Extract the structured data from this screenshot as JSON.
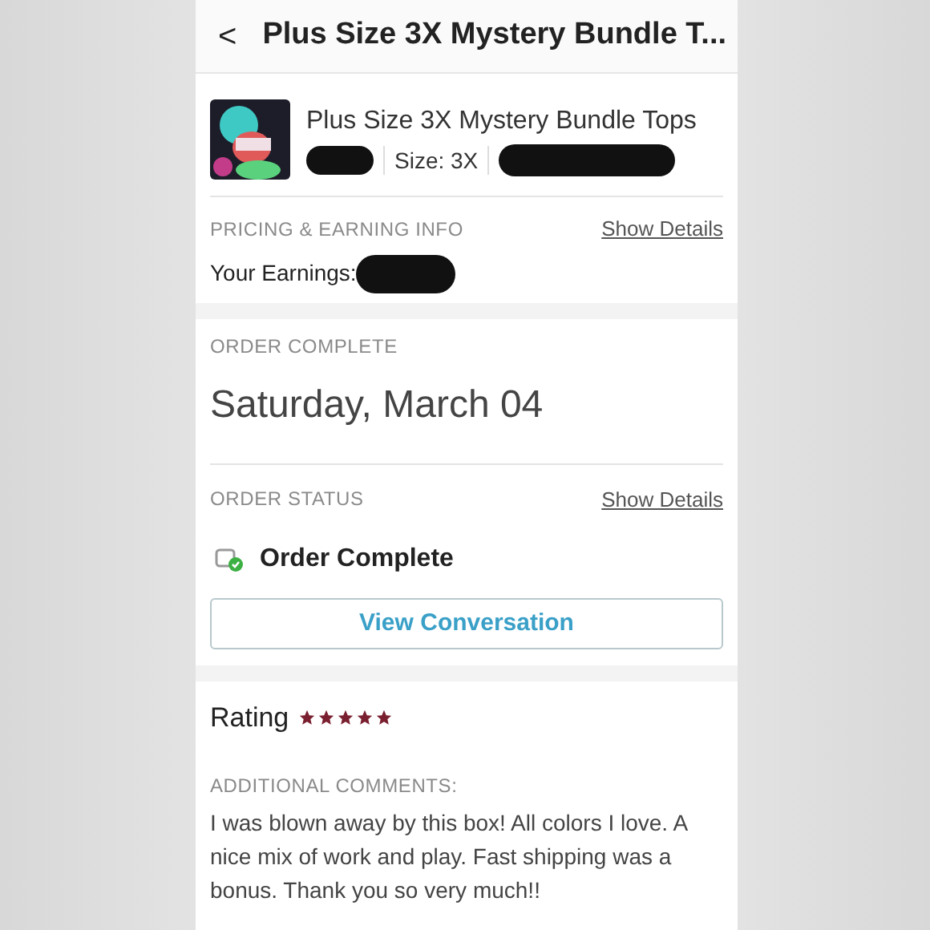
{
  "header": {
    "back": "<",
    "title": "Plus Size 3X Mystery Bundle T..."
  },
  "product": {
    "name": "Plus Size 3X Mystery Bundle Tops",
    "size": "Size: 3X"
  },
  "pricing": {
    "label": "PRICING & EARNING INFO",
    "link": "Show Details",
    "earnings_label": "Your Earnings:"
  },
  "order_complete": {
    "label": "ORDER COMPLETE",
    "date": "Saturday, March 04"
  },
  "order_status": {
    "label": "ORDER STATUS",
    "link": "Show Details",
    "status": "Order Complete",
    "button": "View Conversation"
  },
  "rating": {
    "label": "Rating",
    "stars": 5,
    "comments_label": "ADDITIONAL COMMENTS:",
    "comment": "I was blown away by this box! All colors I love. A nice mix of work and play. Fast shipping was a bonus. Thank you so very much!!"
  }
}
